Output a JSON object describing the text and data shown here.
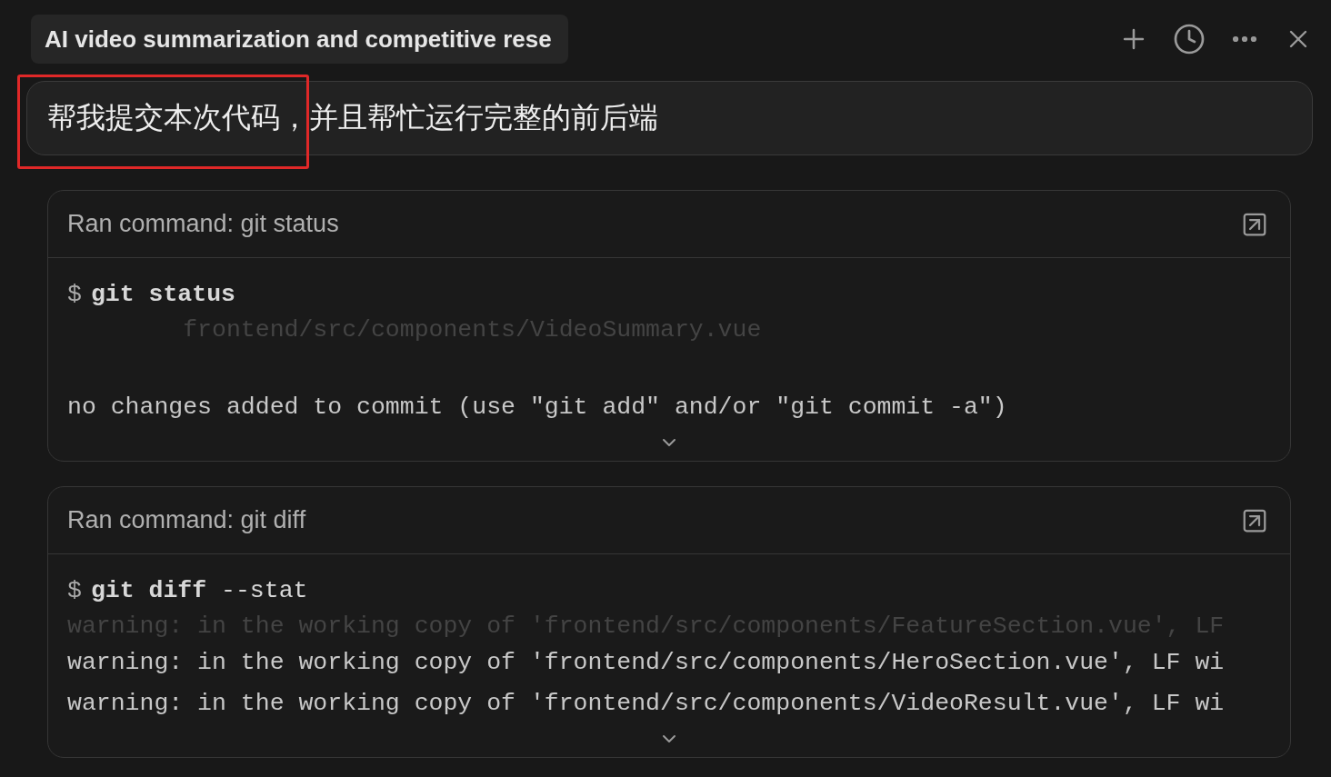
{
  "header": {
    "title": "AI video summarization and competitive rese"
  },
  "message": {
    "text": "帮我提交本次代码，并且帮忙运行完整的前后端",
    "highlighted": true
  },
  "commands": [
    {
      "title": "Ran command: git status",
      "prompt": "$",
      "command": "**git status**",
      "lines": [
        {
          "kind": "faded",
          "text": "        frontend/src/components/VideoSummary.vue"
        },
        {
          "kind": "blank"
        },
        {
          "kind": "normal",
          "text": "no changes added to commit (use \"git add\" and/or \"git commit -a\")"
        }
      ]
    },
    {
      "title": "Ran command: git diff",
      "prompt": "$",
      "command": "**git diff** --stat",
      "lines": [
        {
          "kind": "faded",
          "text": "warning: in the working copy of 'frontend/src/components/FeatureSection.vue', LF"
        },
        {
          "kind": "normal",
          "text": "warning: in the working copy of 'frontend/src/components/HeroSection.vue', LF wi"
        },
        {
          "kind": "normal",
          "text": "warning: in the working copy of 'frontend/src/components/VideoResult.vue', LF wi"
        }
      ]
    }
  ]
}
